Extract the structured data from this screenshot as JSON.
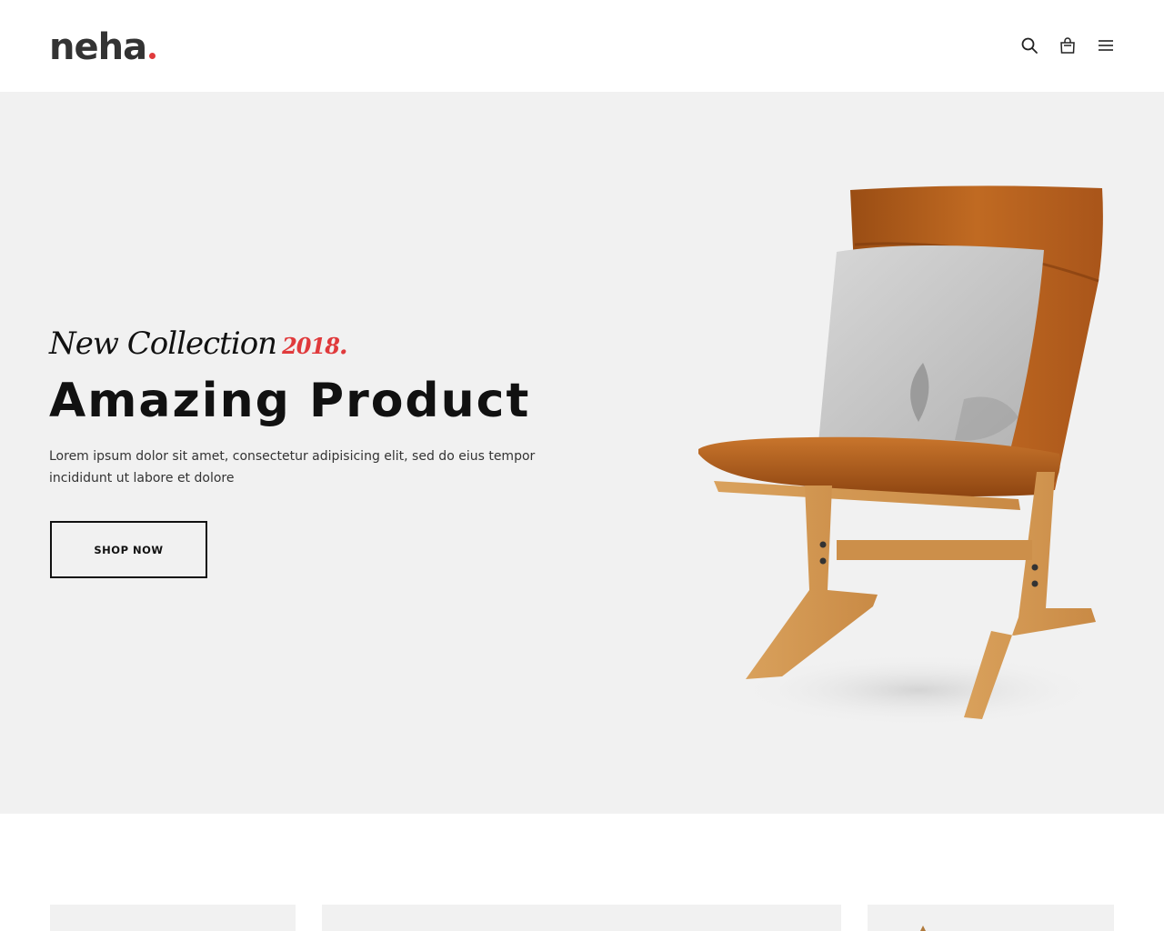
{
  "brand": {
    "name": "neha",
    "accent_color": "#e03a3c"
  },
  "header": {
    "icons": [
      "search-icon",
      "cart-icon",
      "menu-icon"
    ]
  },
  "hero": {
    "subtitle": "New Collection",
    "subtitle_year": "2018",
    "subtitle_dot": ".",
    "title": "Amazing Product",
    "description": "Lorem ipsum dolor sit amet, consectetur adipisicing elit, sed do eius tempor incididunt ut labore et dolore",
    "button_label": "SHOP NOW",
    "background_color": "#f1f1f1"
  }
}
